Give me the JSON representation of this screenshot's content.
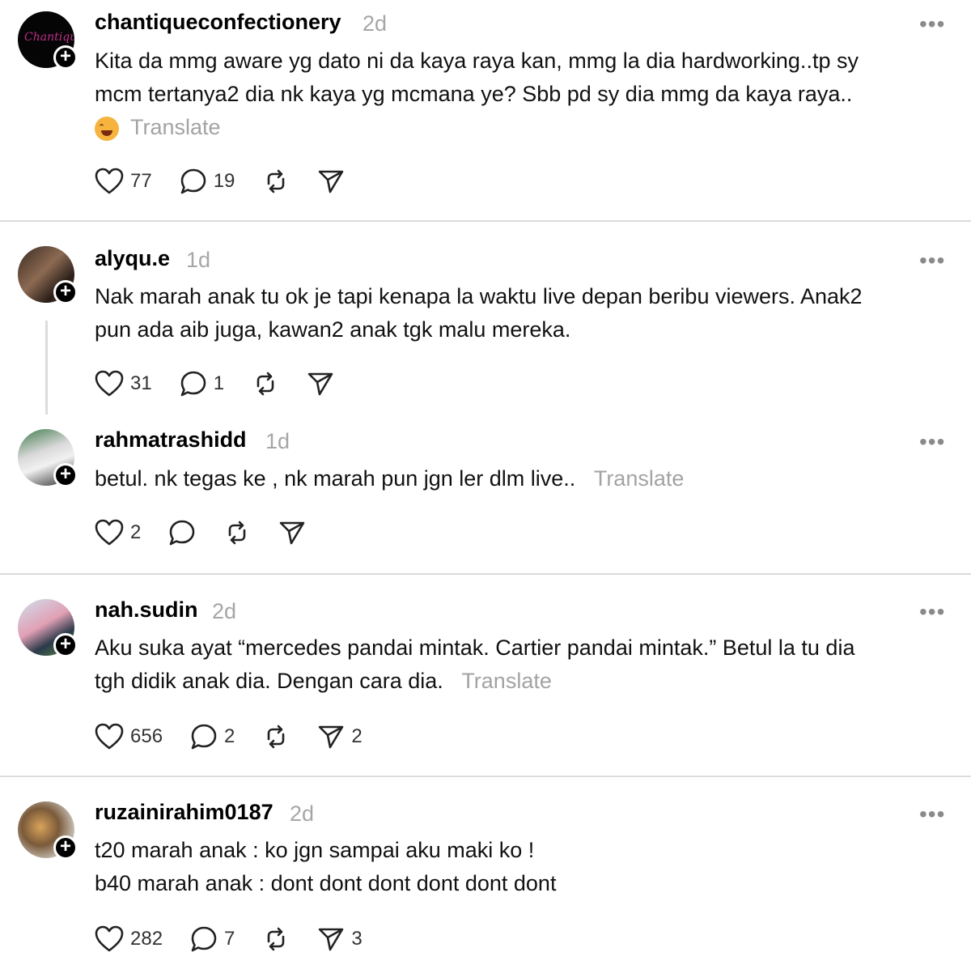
{
  "posts": [
    {
      "username": "chantiqueconfectionery",
      "time": "2d",
      "lines": [
        "Kita da mmg aware yg dato ni da kaya raya kan, mmg la dia hardworking..tp sy",
        "mcm tertanya2 dia nk kaya yg mcmana ye? Sbb pd sy dia mmg da kaya raya.."
      ],
      "translate": "Translate",
      "likes": "77",
      "replies": "19",
      "reposts": "",
      "shares": ""
    },
    {
      "username": "alyqu.e",
      "time": "1d",
      "lines": [
        "Nak marah anak tu ok je tapi kenapa la waktu live depan beribu viewers. Anak2",
        "pun ada aib juga, kawan2 anak tgk malu mereka."
      ],
      "translate": "",
      "likes": "31",
      "replies": "1",
      "reposts": "",
      "shares": ""
    },
    {
      "username": "rahmatrashidd",
      "time": "1d",
      "lines": [
        "betul. nk tegas ke , nk marah pun jgn ler dlm live.."
      ],
      "translate": "Translate",
      "likes": "2",
      "replies": "",
      "reposts": "",
      "shares": ""
    },
    {
      "username": "nah.sudin",
      "time": "2d",
      "lines": [
        "Aku suka ayat “mercedes pandai mintak. Cartier pandai mintak.” Betul la tu dia",
        "tgh didik anak dia. Dengan cara dia."
      ],
      "translate": "Translate",
      "likes": "656",
      "replies": "2",
      "reposts": "",
      "shares": "2"
    },
    {
      "username": "ruzainirahim0187",
      "time": "2d",
      "lines": [
        "t20 marah anak : ko jgn sampai aku maki ko !",
        "b40 marah anak : dont dont dont dont dont dont"
      ],
      "translate": "",
      "likes": "282",
      "replies": "7",
      "reposts": "",
      "shares": "3"
    }
  ],
  "more_label": "•••",
  "avatar_text": "Chantique",
  "colors": {
    "divider": "#dcdcdc",
    "muted": "#a6a6a6",
    "text": "#111111"
  }
}
